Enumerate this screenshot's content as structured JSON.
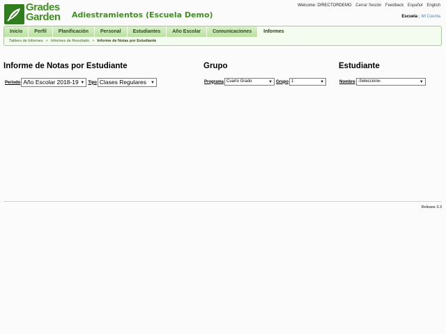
{
  "app": {
    "logo_line1": "Grades",
    "logo_line2": "Garden",
    "school_name": "Adiestramientos (Escuela Demo)"
  },
  "toplinks": {
    "welcome": "Welcome: DIRECTORDEMO",
    "logout": "Cerrar Sesión",
    "feedback": "Feedback",
    "lang_es": "Español",
    "lang_en": "English"
  },
  "rolebar": {
    "active": "Escuela",
    "separator": "|",
    "other": "Mi Cuenta"
  },
  "nav": {
    "tabs": [
      {
        "label": "Inicio"
      },
      {
        "label": "Perfil"
      },
      {
        "label": "Planificación"
      },
      {
        "label": "Personal"
      },
      {
        "label": "Estudiantes"
      },
      {
        "label": "Año Escolar"
      },
      {
        "label": "Comunicaciones"
      },
      {
        "label": "Informes"
      }
    ],
    "active_tab": "Informes"
  },
  "breadcrumb": {
    "items": [
      "Tablero de Informes",
      "Informes de Resultado"
    ],
    "current": "Informe de Notas por Estudiante",
    "separator": ">"
  },
  "report": {
    "title": "Informe de Notas por Estudiante",
    "periodo_label": "Periodo",
    "periodo_value": "Año Escolar 2018-19",
    "tipo_label": "Tipo",
    "tipo_value": "Clases Regulares"
  },
  "grupo": {
    "title": "Grupo",
    "programa_label": "Programa",
    "programa_value": "Cuarto Grado",
    "grupo_label": "Grupo",
    "grupo_value": "1"
  },
  "estudiante": {
    "title": "Estudiante",
    "nombre_label": "Nombre",
    "nombre_value": "-Seleccione-"
  },
  "footer": {
    "release": "Release 3.3"
  },
  "colors": {
    "brand_green": "#3f8f22",
    "tab_green": "#b9e19f",
    "logo_box": "#2f7d1d"
  },
  "icons": {
    "logo": "leaf-logo-icon",
    "select_arrow": "chevron-down-icon"
  }
}
